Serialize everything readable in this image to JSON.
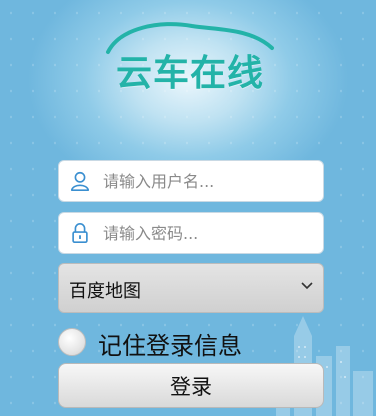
{
  "app": {
    "logo_text": "云车在线",
    "brand_color": "#23b3a8"
  },
  "form": {
    "username": {
      "placeholder": "请输入用户名...",
      "value": "",
      "icon": "user-icon"
    },
    "password": {
      "placeholder": "请输入密码...",
      "value": "",
      "icon": "lock-icon"
    },
    "map_select": {
      "selected": "百度地图",
      "icon": "chevron-down-icon"
    },
    "remember": {
      "label": "记住登录信息",
      "checked": false
    },
    "login_button": {
      "label": "登录"
    }
  }
}
